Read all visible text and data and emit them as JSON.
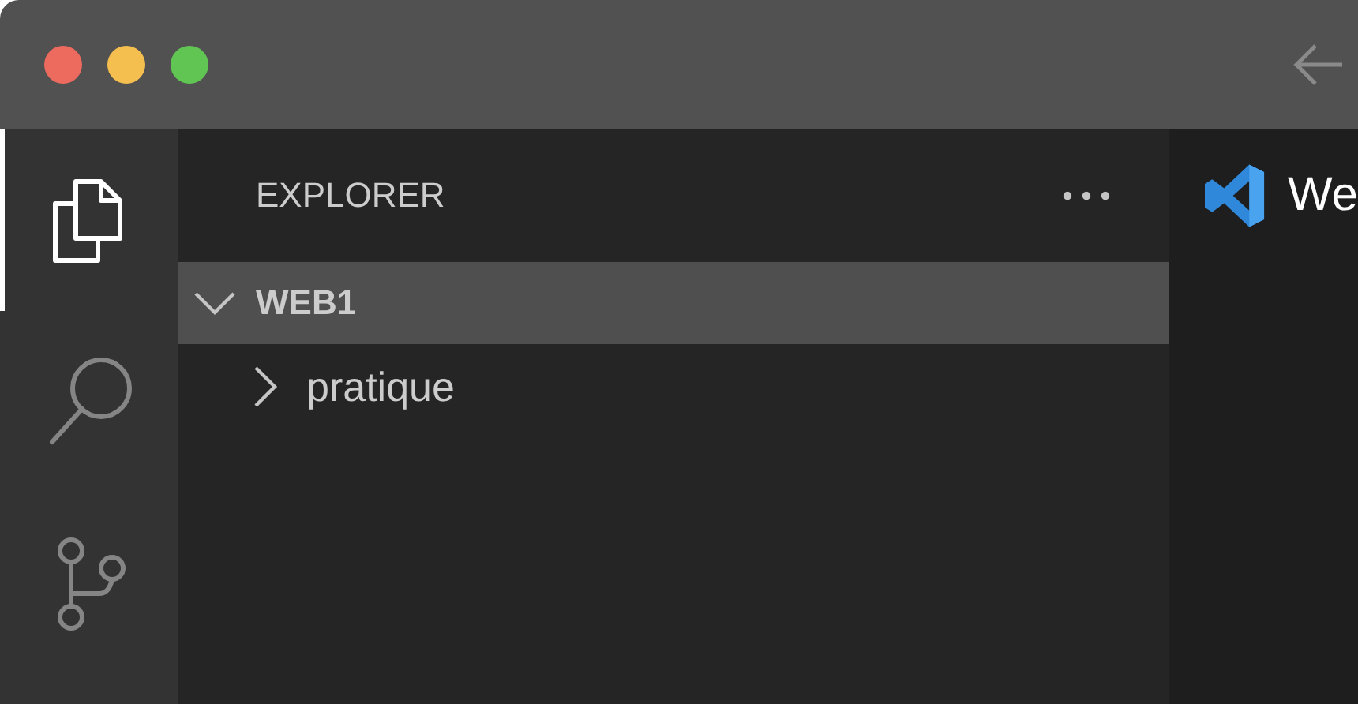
{
  "activity_bar": {
    "items": [
      {
        "kind": "files",
        "selected": true
      },
      {
        "kind": "search",
        "selected": false
      },
      {
        "kind": "source-control",
        "selected": false
      }
    ]
  },
  "sidebar": {
    "title": "EXPLORER",
    "tree": [
      {
        "label": "WEB1",
        "expanded": true,
        "children": [
          {
            "label": "pratique",
            "expanded": false
          }
        ]
      }
    ]
  },
  "editor": {
    "tab": {
      "label": "We"
    }
  }
}
